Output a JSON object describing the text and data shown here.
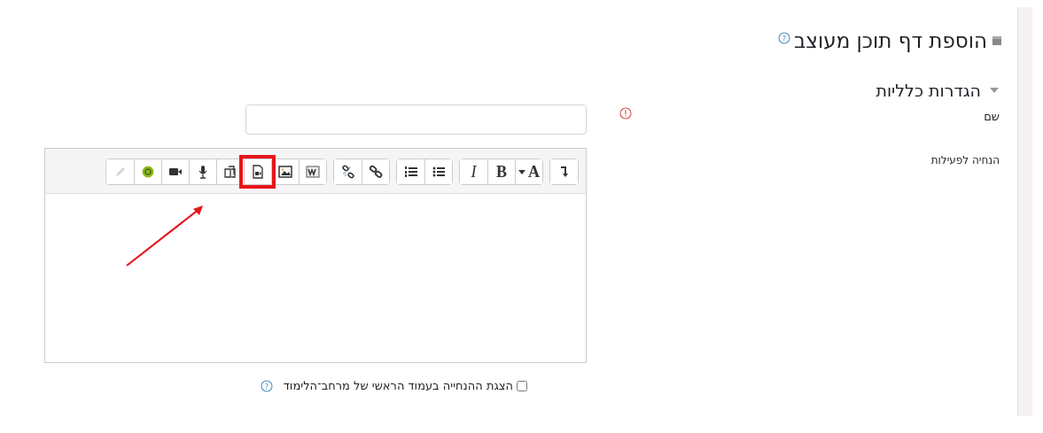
{
  "page_title": "הוספת דף תוכן מעוצב",
  "title_help": "?",
  "section": {
    "title": "הגדרות כלליות",
    "expanded": true
  },
  "fields": [
    {
      "kind": "text",
      "label": "שם",
      "required": true
    },
    {
      "kind": "editor",
      "label": "הנחיה לפעילות"
    }
  ],
  "toolbar": [
    [
      {
        "kind": "icon"
      }
    ],
    [
      {
        "kind": "dropdown",
        "label": "A"
      },
      {
        "kind": "bold",
        "label": "B"
      },
      {
        "kind": "italic",
        "label": "I"
      }
    ],
    [
      {
        "kind": "icon"
      },
      {
        "kind": "icon"
      }
    ],
    [
      {
        "kind": "icon"
      },
      {
        "kind": "icon"
      }
    ],
    [
      {
        "kind": "icon"
      },
      {
        "kind": "icon"
      },
      {
        "kind": "icon",
        "highlighted": true
      },
      {
        "kind": "icon"
      },
      {
        "kind": "icon"
      },
      {
        "kind": "icon"
      },
      {
        "kind": "icon"
      },
      {
        "kind": "icon",
        "disabled": true
      }
    ]
  ],
  "show_description": {
    "label": "הצגת ההנחייה בעמוד הראשי של מרחב־הלימוד",
    "checked": false,
    "help": "?"
  }
}
